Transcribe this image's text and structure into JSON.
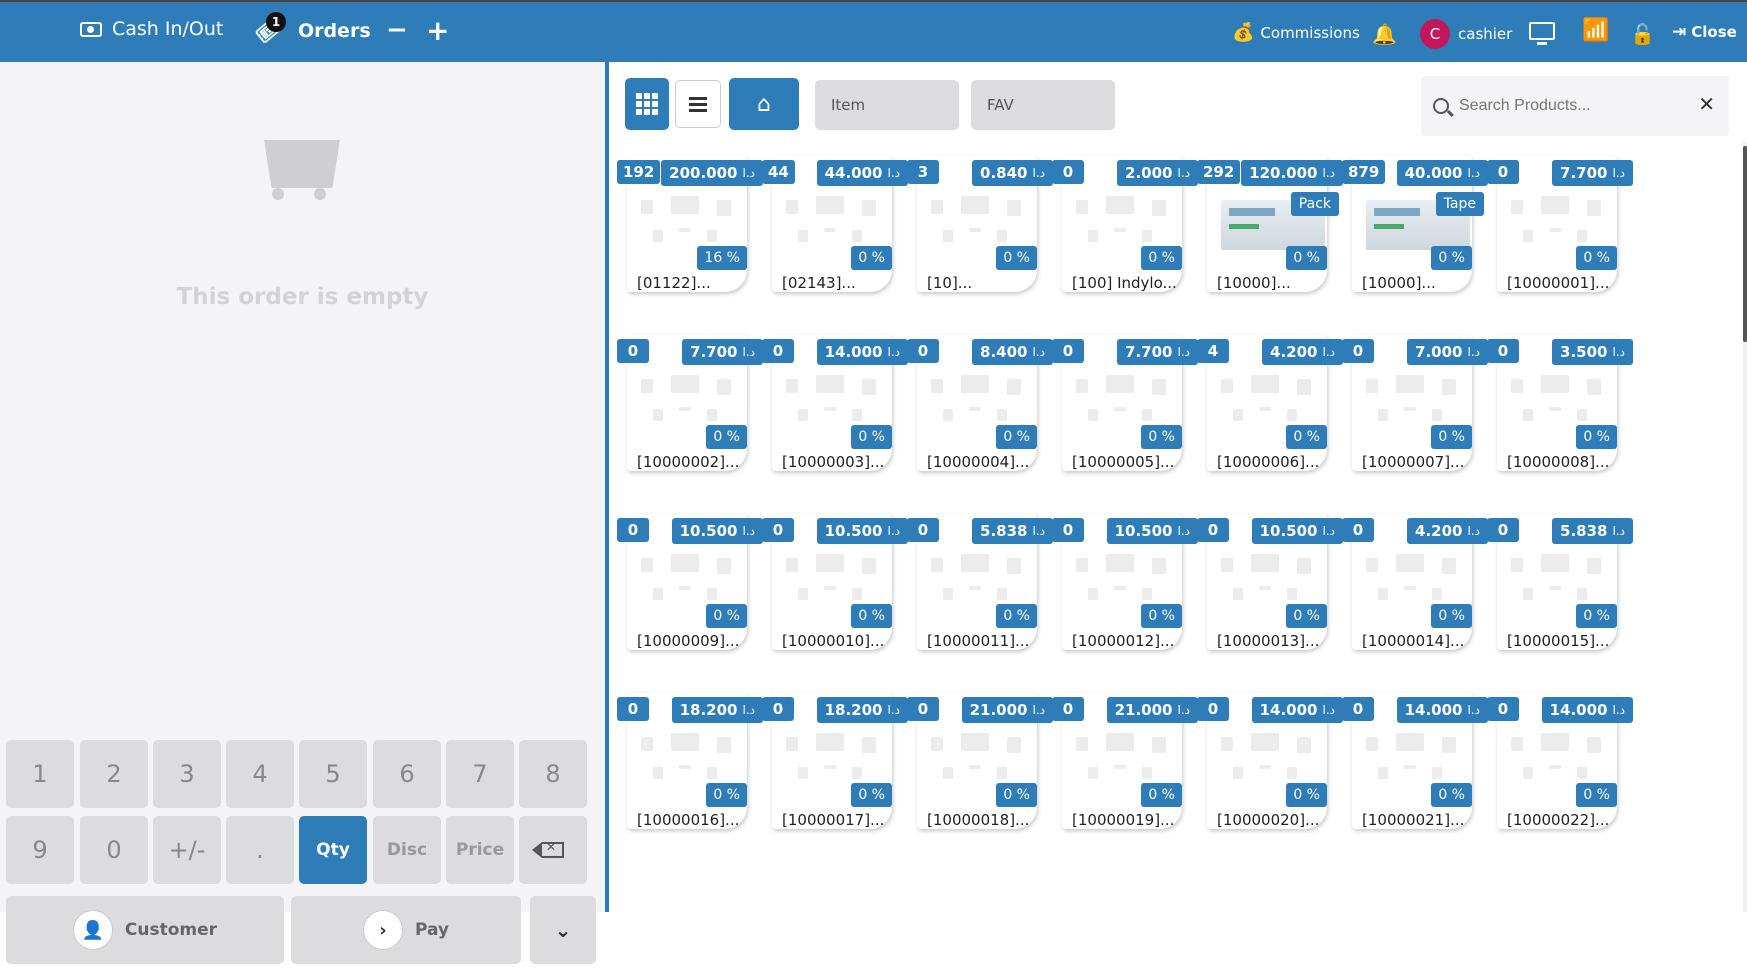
{
  "topbar": {
    "cash_label": "Cash In/Out",
    "orders_label": "Orders",
    "orders_count": "1",
    "minus": "−",
    "plus": "+",
    "commissions_label": "Commissions",
    "user_initial": "C",
    "user_name": "cashier",
    "close_label": "Close",
    "accent": "#2e7db8"
  },
  "order": {
    "empty_text": "This order is empty"
  },
  "numpad": {
    "keys_row1": [
      "1",
      "2",
      "3",
      "4",
      "5",
      "6",
      "7",
      "8"
    ],
    "keys_row2": [
      "9",
      "0",
      "+/-",
      ".",
      "Qty",
      "Disc",
      "Price"
    ],
    "active_mode": "Qty",
    "customer_label": "Customer",
    "pay_label": "Pay"
  },
  "toolbar": {
    "category_item": "Item",
    "category_fav": "FAV",
    "search_placeholder": "Search Products..."
  },
  "currency": "د.ا",
  "products": [
    {
      "qty": "192",
      "price": "200.000",
      "disc": "16 %",
      "name": "[01122]..."
    },
    {
      "qty": "44",
      "price": "44.000",
      "disc": "0 %",
      "name": "[02143]..."
    },
    {
      "qty": "3",
      "price": "0.840",
      "disc": "0 %",
      "name": "[10]..."
    },
    {
      "qty": "0",
      "price": "2.000",
      "disc": "0 %",
      "name": "[100] Indylo..."
    },
    {
      "qty": "292",
      "price": "120.000",
      "disc": "0 %",
      "name": "[10000]...",
      "uom": "Pack",
      "has_image": true
    },
    {
      "qty": "879",
      "price": "40.000",
      "disc": "0 %",
      "name": "[10000]...",
      "uom": "Tape",
      "has_image": true
    },
    {
      "qty": "0",
      "price": "7.700",
      "disc": "0 %",
      "name": "[10000001]..."
    },
    {
      "qty": "0",
      "price": "7.700",
      "disc": "0 %",
      "name": "[10000002]..."
    },
    {
      "qty": "0",
      "price": "14.000",
      "disc": "0 %",
      "name": "[10000003]..."
    },
    {
      "qty": "0",
      "price": "8.400",
      "disc": "0 %",
      "name": "[10000004]..."
    },
    {
      "qty": "0",
      "price": "7.700",
      "disc": "0 %",
      "name": "[10000005]..."
    },
    {
      "qty": "4",
      "price": "4.200",
      "disc": "0 %",
      "name": "[10000006]..."
    },
    {
      "qty": "0",
      "price": "7.000",
      "disc": "0 %",
      "name": "[10000007]..."
    },
    {
      "qty": "0",
      "price": "3.500",
      "disc": "0 %",
      "name": "[10000008]..."
    },
    {
      "qty": "0",
      "price": "10.500",
      "disc": "0 %",
      "name": "[10000009]..."
    },
    {
      "qty": "0",
      "price": "10.500",
      "disc": "0 %",
      "name": "[10000010]..."
    },
    {
      "qty": "0",
      "price": "5.838",
      "disc": "0 %",
      "name": "[10000011]..."
    },
    {
      "qty": "0",
      "price": "10.500",
      "disc": "0 %",
      "name": "[10000012]..."
    },
    {
      "qty": "0",
      "price": "10.500",
      "disc": "0 %",
      "name": "[10000013]..."
    },
    {
      "qty": "0",
      "price": "4.200",
      "disc": "0 %",
      "name": "[10000014]..."
    },
    {
      "qty": "0",
      "price": "5.838",
      "disc": "0 %",
      "name": "[10000015]..."
    },
    {
      "qty": "0",
      "price": "18.200",
      "disc": "0 %",
      "name": "[10000016]..."
    },
    {
      "qty": "0",
      "price": "18.200",
      "disc": "0 %",
      "name": "[10000017]..."
    },
    {
      "qty": "0",
      "price": "21.000",
      "disc": "0 %",
      "name": "[10000018]..."
    },
    {
      "qty": "0",
      "price": "21.000",
      "disc": "0 %",
      "name": "[10000019]..."
    },
    {
      "qty": "0",
      "price": "14.000",
      "disc": "0 %",
      "name": "[10000020]..."
    },
    {
      "qty": "0",
      "price": "14.000",
      "disc": "0 %",
      "name": "[10000021]..."
    },
    {
      "qty": "0",
      "price": "14.000",
      "disc": "0 %",
      "name": "[10000022]..."
    }
  ]
}
